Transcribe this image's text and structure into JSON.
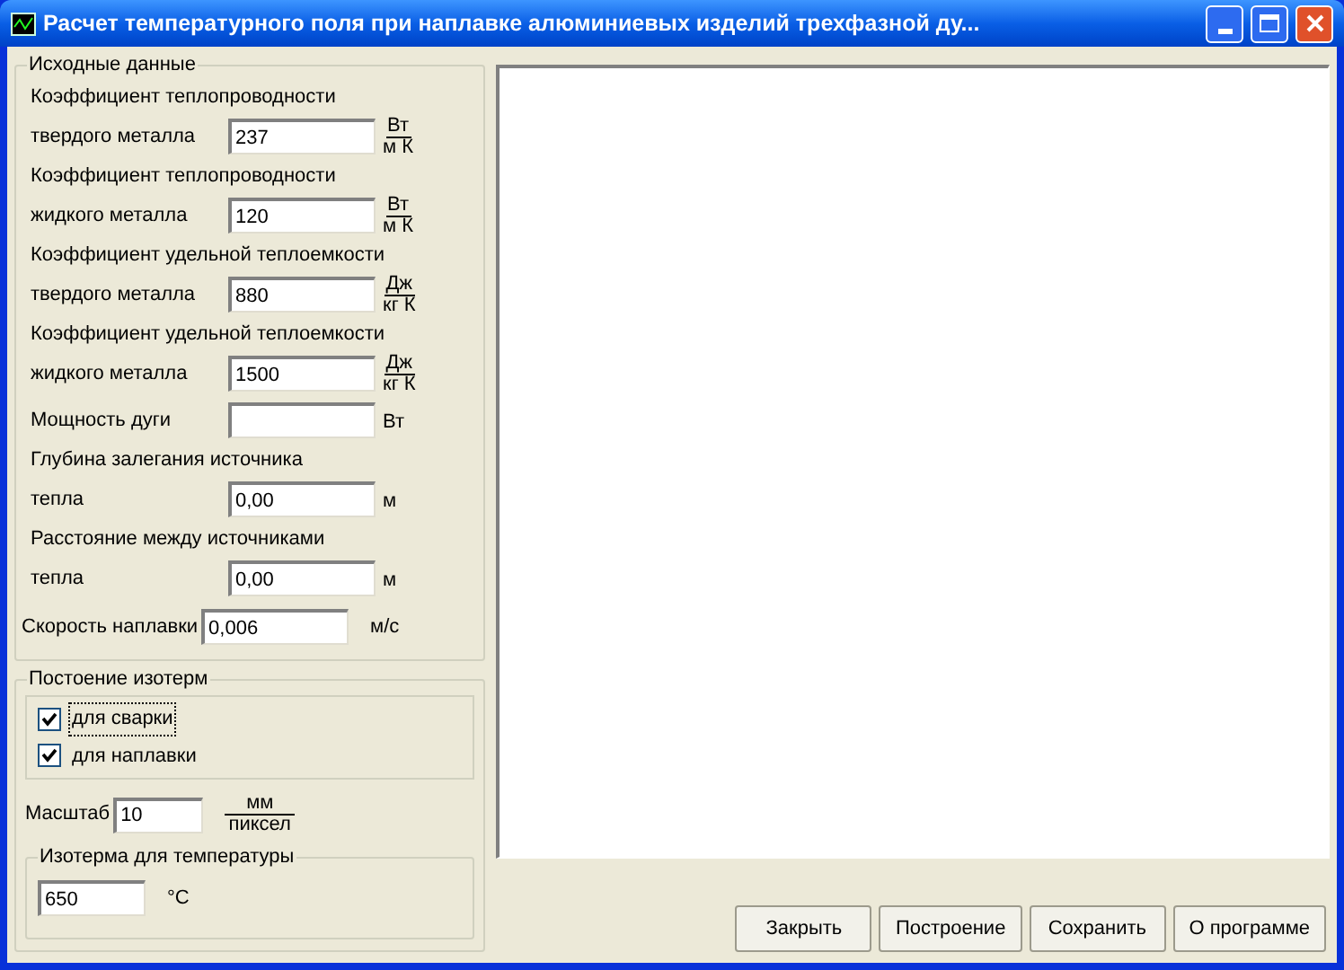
{
  "window": {
    "title": "Расчет температурного поля при наплавке алюминиевых изделий трехфазной ду..."
  },
  "source_data": {
    "title": "Исходные данные",
    "params": [
      {
        "caption": "Коэффициент теплопроводности",
        "label": "твердого металла",
        "value": "237",
        "unit": {
          "kind": "fraction",
          "numerator": "Вт",
          "denominator": "м К"
        }
      },
      {
        "caption": "Коэффициент теплопроводности",
        "label": "жидкого металла",
        "value": "120",
        "unit": {
          "kind": "fraction",
          "numerator": "Вт",
          "denominator": "м К"
        }
      },
      {
        "caption": "Коэффициент удельной теплоемкости",
        "label": "твердого металла",
        "value": "880",
        "unit": {
          "kind": "fraction",
          "numerator": "Дж",
          "denominator": "кг К"
        }
      },
      {
        "caption": "Коэффициент удельной теплоемкости",
        "label": "жидкого металла",
        "value": "1500",
        "unit": {
          "kind": "fraction",
          "numerator": "Дж",
          "denominator": "кг К"
        }
      },
      {
        "label": "Мощность дуги",
        "unit": {
          "kind": "plain",
          "text": "Вт"
        }
      },
      {
        "caption": "Глубина залегания источника",
        "label": "тепла",
        "value": "0,00",
        "unit": {
          "kind": "plain",
          "text": "м"
        }
      },
      {
        "caption": "Расстояние между источниками",
        "label": "тепла",
        "value": "0,00",
        "unit": {
          "kind": "plain",
          "text": "м"
        }
      }
    ],
    "speed": {
      "label": "Скорость наплавки",
      "value": "0,006",
      "unit": "м/с"
    }
  },
  "isotherms": {
    "title": "Постоение изотерм",
    "checkboxes": [
      {
        "label": "для сварки",
        "checked": true,
        "focused": true
      },
      {
        "label": "для наплавки",
        "checked": true,
        "focused": false
      }
    ],
    "scale": {
      "label": "Масштаб",
      "value": "10",
      "numerator": "мм",
      "denominator": "пиксел"
    },
    "temperature": {
      "title": "Изотерма для температуры",
      "value": "650",
      "unit": "°С"
    }
  },
  "buttons": [
    "Закрыть",
    "Построение",
    "Сохранить",
    "О программе"
  ]
}
